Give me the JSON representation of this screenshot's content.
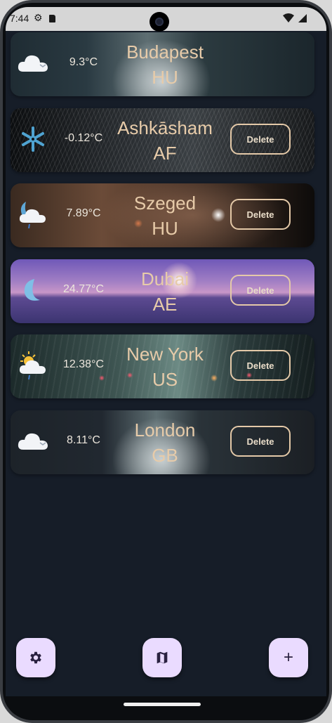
{
  "status_bar": {
    "time": "7:44",
    "settings_glyph": "⚙",
    "wifi_glyph": "▾",
    "signal_glyph": "◢"
  },
  "cities": [
    {
      "temp": "9.3°C",
      "name": "Budapest",
      "country": "HU",
      "icon": "cloud-icon",
      "delete_label": ""
    },
    {
      "temp": "-0.12°C",
      "name": "Ashkāsham",
      "country": "AF",
      "icon": "snowflake-icon",
      "delete_label": "Delete"
    },
    {
      "temp": "7.89°C",
      "name": "Szeged",
      "country": "HU",
      "icon": "moon-cloud-rain-icon",
      "delete_label": "Delete"
    },
    {
      "temp": "24.77°C",
      "name": "Dubai",
      "country": "AE",
      "icon": "moon-icon",
      "delete_label": "Delete"
    },
    {
      "temp": "12.38°C",
      "name": "New York",
      "country": "US",
      "icon": "sun-cloud-rain-icon",
      "delete_label": "Delete"
    },
    {
      "temp": "8.11°C",
      "name": "London",
      "country": "GB",
      "icon": "cloud-icon",
      "delete_label": "Delete"
    }
  ],
  "fabs": {
    "settings": "gear-icon",
    "map": "map-icon",
    "add_label": "+"
  },
  "colors": {
    "background": "#161d28",
    "accent_text": "#e7cba9",
    "fab_bg": "#eadbff"
  }
}
